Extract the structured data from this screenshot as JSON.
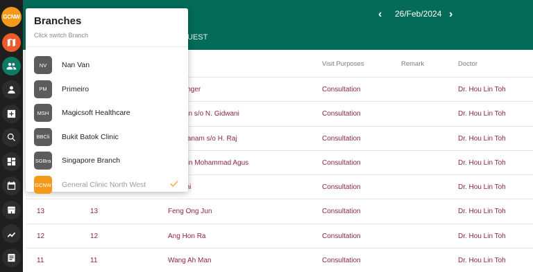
{
  "sidebar": {
    "logo_text": "GCNW",
    "accent_color": "#f49a1a"
  },
  "header": {
    "date": "26/Feb/2024",
    "prev_icon": "‹",
    "next_icon": "›",
    "tab_partial": "UEST",
    "background_color": "#046b59"
  },
  "table": {
    "columns": {
      "purpose": "Visit Purposes",
      "remark": "Remark",
      "doctor": "Doctor"
    },
    "rows": [
      {
        "no": "",
        "queue": "",
        "name": "ightbringer",
        "purpose": "Consultation",
        "remark": "",
        "doctor": "Dr. Hou Lin Toh"
      },
      {
        "no": "",
        "queue": "",
        "name": "Ruhaan s/o N. Gidwani",
        "purpose": "Consultation",
        "remark": "",
        "doctor": "Dr. Hou Lin Toh"
      },
      {
        "no": "",
        "queue": "",
        "name": "Thiruyanam s/o H. Raj",
        "purpose": "Consultation",
        "remark": "",
        "doctor": "Dr. Hou Lin Toh"
      },
      {
        "no": "",
        "queue": "",
        "name": "Noh Bin Mohammad Agus",
        "purpose": "Consultation",
        "remark": "",
        "doctor": "Dr. Hou Lin Toh"
      },
      {
        "no": "",
        "queue": "",
        "name": "Ten Shi",
        "purpose": "Consultation",
        "remark": "",
        "doctor": "Dr. Hou Lin Toh"
      },
      {
        "no": "13",
        "queue": "13",
        "name": "Feng Ong Jun",
        "purpose": "Consultation",
        "remark": "",
        "doctor": "Dr. Hou Lin Toh"
      },
      {
        "no": "12",
        "queue": "12",
        "name": "Ang Hon Ra",
        "purpose": "Consultation",
        "remark": "",
        "doctor": "Dr. Hou Lin Toh"
      },
      {
        "no": "11",
        "queue": "11",
        "name": "Wang Ah Man",
        "purpose": "Consultation",
        "remark": "",
        "doctor": "Dr. Hou Lin Toh"
      }
    ]
  },
  "branches": {
    "title": "Branches",
    "subtitle": "Click switch Branch",
    "items": [
      {
        "avatar": "NV",
        "name": "Nan Van",
        "selected": false
      },
      {
        "avatar": "PM",
        "name": "Primeiro",
        "selected": false
      },
      {
        "avatar": "MSH",
        "name": "Magicsoft Healthcare",
        "selected": false
      },
      {
        "avatar": "BBCli",
        "name": "Bukit Batok Clinic",
        "selected": false
      },
      {
        "avatar": "SGBra",
        "name": "Singapore Branch",
        "selected": false
      },
      {
        "avatar": "GCNW",
        "name": "General Clinic North West",
        "selected": true
      }
    ],
    "check_color": "#f49a1a"
  }
}
